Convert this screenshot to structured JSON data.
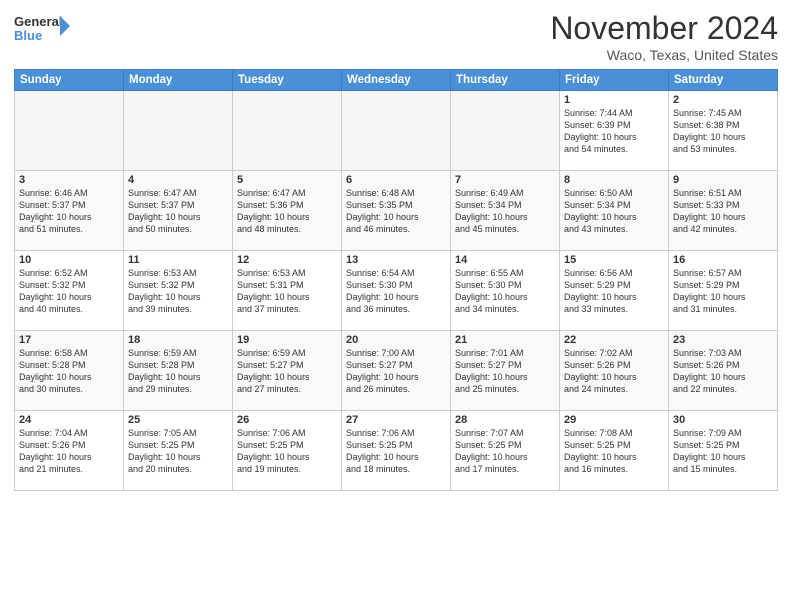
{
  "header": {
    "logo_general": "General",
    "logo_blue": "Blue",
    "month": "November 2024",
    "location": "Waco, Texas, United States"
  },
  "weekdays": [
    "Sunday",
    "Monday",
    "Tuesday",
    "Wednesday",
    "Thursday",
    "Friday",
    "Saturday"
  ],
  "weeks": [
    [
      {
        "day": "",
        "info": ""
      },
      {
        "day": "",
        "info": ""
      },
      {
        "day": "",
        "info": ""
      },
      {
        "day": "",
        "info": ""
      },
      {
        "day": "",
        "info": ""
      },
      {
        "day": "1",
        "info": "Sunrise: 7:44 AM\nSunset: 6:39 PM\nDaylight: 10 hours\nand 54 minutes."
      },
      {
        "day": "2",
        "info": "Sunrise: 7:45 AM\nSunset: 6:38 PM\nDaylight: 10 hours\nand 53 minutes."
      }
    ],
    [
      {
        "day": "3",
        "info": "Sunrise: 6:46 AM\nSunset: 5:37 PM\nDaylight: 10 hours\nand 51 minutes."
      },
      {
        "day": "4",
        "info": "Sunrise: 6:47 AM\nSunset: 5:37 PM\nDaylight: 10 hours\nand 50 minutes."
      },
      {
        "day": "5",
        "info": "Sunrise: 6:47 AM\nSunset: 5:36 PM\nDaylight: 10 hours\nand 48 minutes."
      },
      {
        "day": "6",
        "info": "Sunrise: 6:48 AM\nSunset: 5:35 PM\nDaylight: 10 hours\nand 46 minutes."
      },
      {
        "day": "7",
        "info": "Sunrise: 6:49 AM\nSunset: 5:34 PM\nDaylight: 10 hours\nand 45 minutes."
      },
      {
        "day": "8",
        "info": "Sunrise: 6:50 AM\nSunset: 5:34 PM\nDaylight: 10 hours\nand 43 minutes."
      },
      {
        "day": "9",
        "info": "Sunrise: 6:51 AM\nSunset: 5:33 PM\nDaylight: 10 hours\nand 42 minutes."
      }
    ],
    [
      {
        "day": "10",
        "info": "Sunrise: 6:52 AM\nSunset: 5:32 PM\nDaylight: 10 hours\nand 40 minutes."
      },
      {
        "day": "11",
        "info": "Sunrise: 6:53 AM\nSunset: 5:32 PM\nDaylight: 10 hours\nand 39 minutes."
      },
      {
        "day": "12",
        "info": "Sunrise: 6:53 AM\nSunset: 5:31 PM\nDaylight: 10 hours\nand 37 minutes."
      },
      {
        "day": "13",
        "info": "Sunrise: 6:54 AM\nSunset: 5:30 PM\nDaylight: 10 hours\nand 36 minutes."
      },
      {
        "day": "14",
        "info": "Sunrise: 6:55 AM\nSunset: 5:30 PM\nDaylight: 10 hours\nand 34 minutes."
      },
      {
        "day": "15",
        "info": "Sunrise: 6:56 AM\nSunset: 5:29 PM\nDaylight: 10 hours\nand 33 minutes."
      },
      {
        "day": "16",
        "info": "Sunrise: 6:57 AM\nSunset: 5:29 PM\nDaylight: 10 hours\nand 31 minutes."
      }
    ],
    [
      {
        "day": "17",
        "info": "Sunrise: 6:58 AM\nSunset: 5:28 PM\nDaylight: 10 hours\nand 30 minutes."
      },
      {
        "day": "18",
        "info": "Sunrise: 6:59 AM\nSunset: 5:28 PM\nDaylight: 10 hours\nand 29 minutes."
      },
      {
        "day": "19",
        "info": "Sunrise: 6:59 AM\nSunset: 5:27 PM\nDaylight: 10 hours\nand 27 minutes."
      },
      {
        "day": "20",
        "info": "Sunrise: 7:00 AM\nSunset: 5:27 PM\nDaylight: 10 hours\nand 26 minutes."
      },
      {
        "day": "21",
        "info": "Sunrise: 7:01 AM\nSunset: 5:27 PM\nDaylight: 10 hours\nand 25 minutes."
      },
      {
        "day": "22",
        "info": "Sunrise: 7:02 AM\nSunset: 5:26 PM\nDaylight: 10 hours\nand 24 minutes."
      },
      {
        "day": "23",
        "info": "Sunrise: 7:03 AM\nSunset: 5:26 PM\nDaylight: 10 hours\nand 22 minutes."
      }
    ],
    [
      {
        "day": "24",
        "info": "Sunrise: 7:04 AM\nSunset: 5:26 PM\nDaylight: 10 hours\nand 21 minutes."
      },
      {
        "day": "25",
        "info": "Sunrise: 7:05 AM\nSunset: 5:25 PM\nDaylight: 10 hours\nand 20 minutes."
      },
      {
        "day": "26",
        "info": "Sunrise: 7:06 AM\nSunset: 5:25 PM\nDaylight: 10 hours\nand 19 minutes."
      },
      {
        "day": "27",
        "info": "Sunrise: 7:06 AM\nSunset: 5:25 PM\nDaylight: 10 hours\nand 18 minutes."
      },
      {
        "day": "28",
        "info": "Sunrise: 7:07 AM\nSunset: 5:25 PM\nDaylight: 10 hours\nand 17 minutes."
      },
      {
        "day": "29",
        "info": "Sunrise: 7:08 AM\nSunset: 5:25 PM\nDaylight: 10 hours\nand 16 minutes."
      },
      {
        "day": "30",
        "info": "Sunrise: 7:09 AM\nSunset: 5:25 PM\nDaylight: 10 hours\nand 15 minutes."
      }
    ]
  ]
}
